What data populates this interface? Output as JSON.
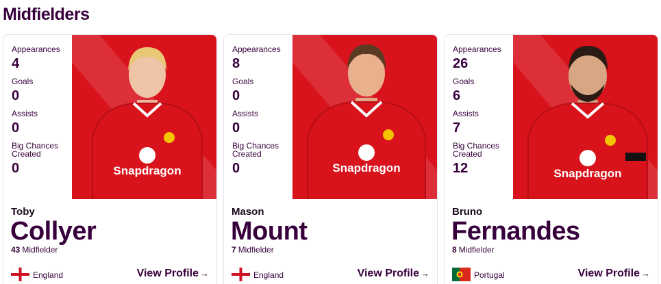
{
  "section": {
    "title": "Midfielders"
  },
  "labels": {
    "appearances": "Appearances",
    "goals": "Goals",
    "assists": "Assists",
    "big_chances": "Big Chances Created",
    "position": "Midfielder",
    "view_profile": "View Profile",
    "arrow": "→"
  },
  "sponsor": "Snapdragon",
  "colors": {
    "brand": "#37003c",
    "kit_red": "#d8131c",
    "photo_bg": "#e1121b"
  },
  "players": [
    {
      "first_name": "Toby",
      "last_name": "Collyer",
      "number": "43",
      "appearances": "4",
      "goals": "0",
      "assists": "0",
      "big_chances": "0",
      "nation": "England",
      "flag": "england-flag",
      "hair": "blond"
    },
    {
      "first_name": "Mason",
      "last_name": "Mount",
      "number": "7",
      "appearances": "8",
      "goals": "0",
      "assists": "0",
      "big_chances": "0",
      "nation": "England",
      "flag": "england-flag",
      "hair": "brown"
    },
    {
      "first_name": "Bruno",
      "last_name": "Fernandes",
      "number": "8",
      "appearances": "26",
      "goals": "6",
      "assists": "7",
      "big_chances": "12",
      "nation": "Portugal",
      "flag": "portugal-flag",
      "hair": "dark"
    }
  ]
}
